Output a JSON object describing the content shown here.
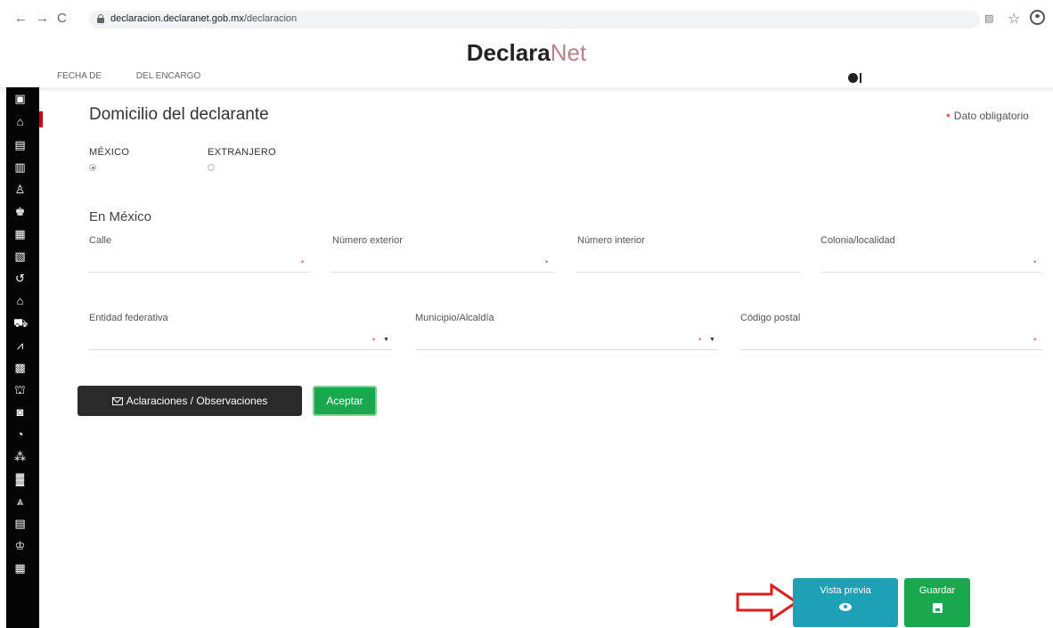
{
  "browser": {
    "url_host": "declaracion.declaranet.gob.mx",
    "url_path": "/declaracion"
  },
  "app": {
    "logo_bold": "Declara",
    "logo_light": "Net"
  },
  "subnav": {
    "item1": "FECHA DE",
    "item2": "DEL ENCARGO"
  },
  "section": {
    "title": "Domicilio del declarante",
    "required_note": "Dato obligatorio"
  },
  "location": {
    "option_mexico": "MÉXICO",
    "option_extranjero": "EXTRANJERO",
    "selected": "MÉXICO",
    "subtitle": "En México"
  },
  "fields": {
    "calle": "Calle",
    "numero_exterior": "Número exterior",
    "numero_interior": "Número interior",
    "colonia": "Colonia/localidad",
    "entidad": "Entidad federativa",
    "municipio": "Municipio/Alcaldía",
    "codigo_postal": "Código postal"
  },
  "buttons": {
    "aclaraciones": "Aclaraciones / Observaciones",
    "aceptar": "Aceptar",
    "vista_previa": "Vista previa",
    "guardar": "Guardar"
  },
  "sidebar_icons": [
    "id-card-icon",
    "home-icon",
    "document-icon",
    "building-icon",
    "people-icon",
    "family-icon",
    "briefcase-icon",
    "chart-doc-icon",
    "history-icon",
    "house-icon",
    "car-icon",
    "line-chart-icon",
    "money-icon",
    "bank-icon",
    "safe-icon",
    "pie-chart-icon",
    "network-icon",
    "company-icon",
    "group-icon",
    "scale-icon",
    "person-icon",
    "calculator-icon"
  ],
  "colors": {
    "accent_red": "#c4001a",
    "required_dot": "#e2606a",
    "preview_teal": "#1ea0b5",
    "save_green": "#1aa84f"
  }
}
